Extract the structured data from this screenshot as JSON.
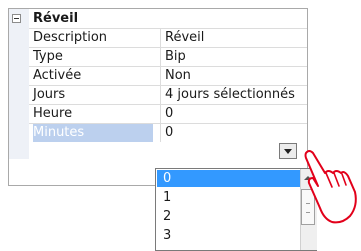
{
  "category": "Réveil",
  "properties": [
    {
      "name": "Description",
      "value": "Réveil"
    },
    {
      "name": "Type",
      "value": "Bip"
    },
    {
      "name": "Activée",
      "value": "Non"
    },
    {
      "name": "Jours",
      "value": "4 jours sélectionnés"
    },
    {
      "name": "Heure",
      "value": "0"
    },
    {
      "name": "Minutes",
      "value": "0"
    }
  ],
  "dropdown": {
    "options": [
      "0",
      "1",
      "2",
      "3"
    ],
    "highlighted": "0"
  },
  "colors": {
    "selection": "#3399ff",
    "selected_label_bg": "#bcd0ee",
    "cursor_stroke": "#e2001a"
  },
  "icons": [
    "collapse-icon",
    "dropdown-arrow-icon",
    "scroll-up-icon",
    "hand-cursor-icon"
  ]
}
